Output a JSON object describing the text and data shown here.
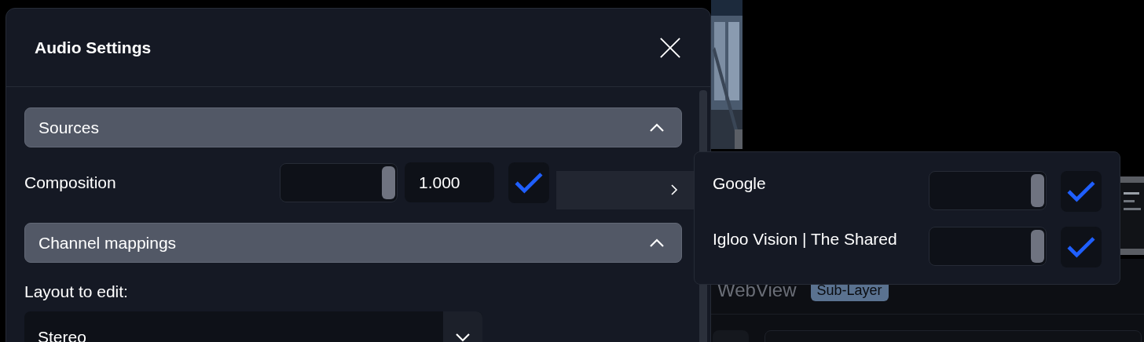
{
  "dialog": {
    "title": "Audio Settings",
    "sources": {
      "title": "Sources",
      "expanded": true,
      "rows": [
        {
          "label": "Composition",
          "level": 1,
          "value": "1.000",
          "checked": true
        }
      ]
    },
    "channel_mappings": {
      "title": "Channel mappings",
      "expanded": true,
      "layout_label": "Layout to edit:",
      "layout_value": "Stereo"
    }
  },
  "sources_popup": {
    "items": [
      {
        "name": "Google",
        "level": 1,
        "checked": true
      },
      {
        "name": "Igloo Vision | The Shared",
        "level": 1,
        "checked": true
      }
    ]
  },
  "background": {
    "title": "WebView",
    "badge": "Sub-Layer"
  }
}
